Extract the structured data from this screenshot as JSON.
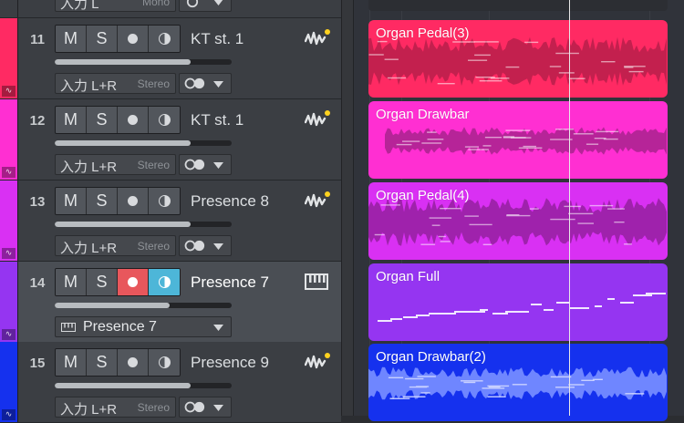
{
  "partial_track": {
    "input_label": "入力 L",
    "input_mode": "Mono"
  },
  "tracks": [
    {
      "number": "11",
      "name": "KT st. 1",
      "color": "#ff2a63",
      "selected": false,
      "rec_armed": false,
      "monitor_on": false,
      "fader_level": 0.77,
      "input_label": "入力 L+R",
      "input_mode": "Stereo",
      "icon": "audio-wave-icon",
      "buttons": {
        "mute": "M",
        "solo": "S"
      },
      "clip": {
        "name": "Organ Pedal(3)",
        "color": "#ff2a63",
        "wave": "#b81f4a"
      }
    },
    {
      "number": "12",
      "name": "KT st. 1",
      "color": "#ff2fd2",
      "selected": false,
      "rec_armed": false,
      "monitor_on": false,
      "fader_level": 0.77,
      "input_label": "入力 L+R",
      "input_mode": "Stereo",
      "icon": "audio-wave-icon",
      "buttons": {
        "mute": "M",
        "solo": "S"
      },
      "clip": {
        "name": "Organ Drawbar",
        "color": "#ff2fd2",
        "wave": "#a9228e"
      }
    },
    {
      "number": "13",
      "name": "Presence 8",
      "color": "#d930f3",
      "selected": false,
      "rec_armed": false,
      "monitor_on": false,
      "fader_level": 0.77,
      "input_label": "入力 L+R",
      "input_mode": "Stereo",
      "icon": "audio-wave-icon",
      "buttons": {
        "mute": "M",
        "solo": "S"
      },
      "clip": {
        "name": "Organ Pedal(4)",
        "color": "#d930f3",
        "wave": "#94209f"
      }
    },
    {
      "number": "14",
      "name": "Presence 7",
      "color": "#9535f1",
      "selected": true,
      "rec_armed": true,
      "monitor_on": true,
      "fader_level": 0.65,
      "instrument_label": "Presence 7",
      "icon": "keyboard-icon",
      "buttons": {
        "mute": "M",
        "solo": "S"
      },
      "clip": {
        "name": "Organ Full",
        "color": "#9535f1",
        "wave": "#f0e6ff"
      }
    },
    {
      "number": "15",
      "name": "Presence 9",
      "color": "#1531ee",
      "selected": false,
      "rec_armed": false,
      "monitor_on": false,
      "fader_level": 0.77,
      "input_label": "入力 L+R",
      "input_mode": "Stereo",
      "icon": "audio-wave-icon",
      "buttons": {
        "mute": "M",
        "solo": "S"
      },
      "clip": {
        "name": "Organ Drawbar(2)",
        "color": "#1531ee",
        "wave": "#6f86ff"
      }
    }
  ]
}
